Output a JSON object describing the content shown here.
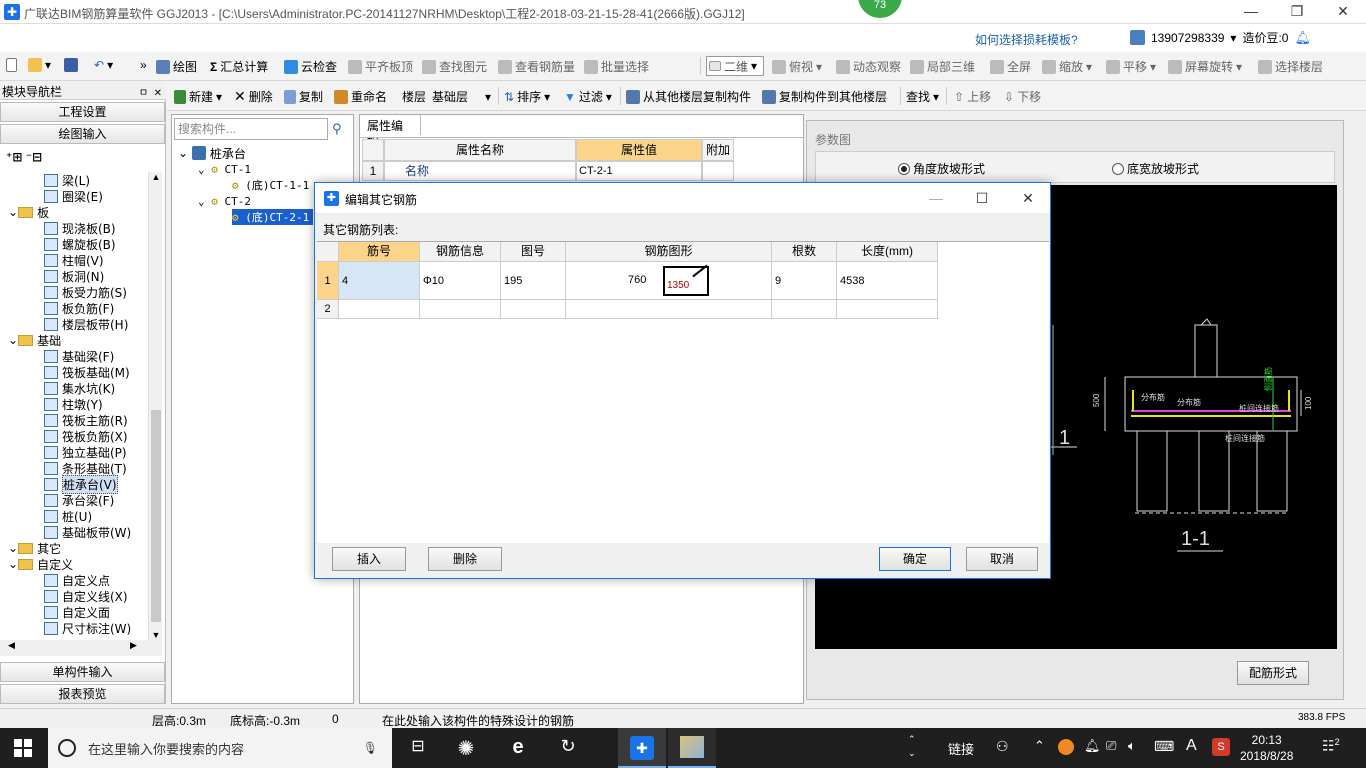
{
  "window": {
    "title": "广联达BIM钢筋算量软件 GGJ2013 - [C:\\Users\\Administrator.PC-20141127NRHM\\Desktop\\工程2-2018-03-21-15-28-41(2666版).GGJ12]",
    "badge": "73",
    "minimize": "—",
    "restore": "❐",
    "close": "✕"
  },
  "inforow": {
    "help_link": "如何选择损耗模板?",
    "phone": "13907298339",
    "bean": "造价豆:0"
  },
  "toolbar1": {
    "draw": "绘图",
    "sum": "Σ",
    "calc": "汇总计算",
    "cloud": "云检查",
    "flat": "平齐板顶",
    "find": "查找图元",
    "view_rebar": "查看钢筋量",
    "batch": "批量选择",
    "view2d": "二维",
    "top_view": "俯视",
    "dyn": "动态观察",
    "local3d": "局部三维",
    "fullscreen": "全屏",
    "zoom": "缩放",
    "pan": "平移",
    "rotate": "屏幕旋转",
    "floor": "选择楼层"
  },
  "toolbar2": {
    "new": "新建",
    "delete": "删除",
    "copy": "复制",
    "rename": "重命名",
    "floor_label": "楼层",
    "floor_value": "基础层",
    "sort": "排序",
    "filter": "过滤",
    "copy_from": "从其他楼层复制构件",
    "copy_to": "复制构件到其他楼层",
    "search": "查找",
    "up": "上移",
    "down": "下移"
  },
  "leftnav": {
    "header": "模块导航栏",
    "project_settings": "工程设置",
    "drawing_input": "绘图输入",
    "single_input": "单构件输入",
    "report": "报表预览",
    "tree": [
      {
        "label": "梁(L)",
        "indent": 2,
        "kind": "item"
      },
      {
        "label": "圈梁(E)",
        "indent": 2,
        "kind": "item"
      },
      {
        "label": "板",
        "indent": 1,
        "kind": "folder"
      },
      {
        "label": "现浇板(B)",
        "indent": 2,
        "kind": "item"
      },
      {
        "label": "螺旋板(B)",
        "indent": 2,
        "kind": "item"
      },
      {
        "label": "柱帽(V)",
        "indent": 2,
        "kind": "item"
      },
      {
        "label": "板洞(N)",
        "indent": 2,
        "kind": "item"
      },
      {
        "label": "板受力筋(S)",
        "indent": 2,
        "kind": "item"
      },
      {
        "label": "板负筋(F)",
        "indent": 2,
        "kind": "item"
      },
      {
        "label": "楼层板带(H)",
        "indent": 2,
        "kind": "item"
      },
      {
        "label": "基础",
        "indent": 1,
        "kind": "folder"
      },
      {
        "label": "基础梁(F)",
        "indent": 2,
        "kind": "item"
      },
      {
        "label": "筏板基础(M)",
        "indent": 2,
        "kind": "item"
      },
      {
        "label": "集水坑(K)",
        "indent": 2,
        "kind": "item"
      },
      {
        "label": "柱墩(Y)",
        "indent": 2,
        "kind": "item"
      },
      {
        "label": "筏板主筋(R)",
        "indent": 2,
        "kind": "item"
      },
      {
        "label": "筏板负筋(X)",
        "indent": 2,
        "kind": "item"
      },
      {
        "label": "独立基础(P)",
        "indent": 2,
        "kind": "item"
      },
      {
        "label": "条形基础(T)",
        "indent": 2,
        "kind": "item"
      },
      {
        "label": "桩承台(V)",
        "indent": 2,
        "kind": "item",
        "selected": true
      },
      {
        "label": "承台梁(F)",
        "indent": 2,
        "kind": "item"
      },
      {
        "label": "桩(U)",
        "indent": 2,
        "kind": "item"
      },
      {
        "label": "基础板带(W)",
        "indent": 2,
        "kind": "item"
      },
      {
        "label": "其它",
        "indent": 1,
        "kind": "folder"
      },
      {
        "label": "自定义",
        "indent": 1,
        "kind": "folder"
      },
      {
        "label": "自定义点",
        "indent": 2,
        "kind": "item"
      },
      {
        "label": "自定义线(X)",
        "indent": 2,
        "kind": "item"
      },
      {
        "label": "自定义面",
        "indent": 2,
        "kind": "item"
      },
      {
        "label": "尺寸标注(W)",
        "indent": 2,
        "kind": "item"
      }
    ]
  },
  "comptree": {
    "search_placeholder": "搜索构件...",
    "root": "桩承台",
    "ct1": "CT-1",
    "ct1_child": "(底)CT-1-1",
    "ct2": "CT-2",
    "ct2_child": "(底)CT-2-1"
  },
  "propedit": {
    "tab": "属性编辑",
    "col_name": "属性名称",
    "col_value": "属性值",
    "col_extra": "附加",
    "row1_no": "1",
    "row1_name": "名称",
    "row1_value": "CT-2-1"
  },
  "param": {
    "title": "参数图",
    "radio1": "角度放坡形式",
    "radio2": "底宽放坡形式",
    "section": "1-1",
    "section_mark": "1",
    "rebar_button": "配筋形式",
    "cad_labels": [
      "分布筋",
      "分布筋",
      "桩间连接筋",
      "桩间连接筋",
      "侧面筋",
      "500",
      "100"
    ]
  },
  "dialog": {
    "title": "编辑其它钢筋",
    "list_label": "其它钢筋列表:",
    "columns": [
      "筋号",
      "钢筋信息",
      "图号",
      "钢筋图形",
      "根数",
      "长度(mm)"
    ],
    "rows": [
      {
        "no": "1",
        "bar": "4",
        "info": "Φ10",
        "fig": "195",
        "shape_a": "760",
        "shape_b": "1350",
        "count": "9",
        "length": "4538"
      },
      {
        "no": "2",
        "bar": "",
        "info": "",
        "fig": "",
        "shape_a": "",
        "shape_b": "",
        "count": "",
        "length": ""
      }
    ],
    "insert": "插入",
    "delete": "删除",
    "ok": "确定",
    "cancel": "取消"
  },
  "statusbar": {
    "floor_h": "层高:0.3m",
    "base_h": "底标高:-0.3m",
    "zero": "0",
    "hint": "在此处输入该构件的特殊设计的钢筋",
    "fps": "383.8 FPS"
  },
  "taskbar": {
    "search": "在这里输入你要搜索的内容",
    "link": "链接",
    "ime": "A",
    "time": "20:13",
    "date": "2018/8/28",
    "notify": "2"
  },
  "colors": {
    "accent": "#1a73e8",
    "header_highlight": "#fbd48a",
    "selection": "#cfe0f5"
  }
}
